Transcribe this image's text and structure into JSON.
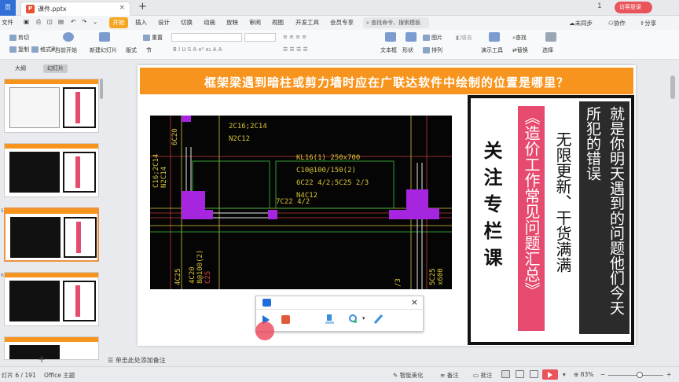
{
  "titlebar": {
    "home": "页",
    "file_name": "课件.pptx",
    "badge": "1",
    "login": "访客登录"
  },
  "menu": {
    "file": "文件",
    "start": "开始",
    "items": [
      "插入",
      "设计",
      "切换",
      "动画",
      "放映",
      "审阅",
      "视图",
      "开发工具",
      "会员专享"
    ],
    "search": "查找命令、搜索模板",
    "unsynced": "未同步",
    "collab": "协作",
    "share": "分享"
  },
  "toolbar": {
    "cut": "剪切",
    "copy": "复制",
    "format_painter": "格式刷",
    "current_start": "当前开始",
    "new_slide": "新建幻灯片",
    "layout": "版式",
    "section": "节",
    "reset": "重置",
    "textbox": "文本框",
    "shape": "形状",
    "arrange": "排列",
    "picture": "图片",
    "fill": "填充",
    "present_tool": "演示工具",
    "find": "查找",
    "replace": "替换",
    "select": "选择"
  },
  "panel": {
    "tab_outline": "大纲",
    "tab_slides": "幻灯片",
    "tooltip": "开始",
    "thumb_numbers": [
      "5",
      "6"
    ]
  },
  "slide": {
    "title": "框架梁遇到暗柱或剪力墙时应在广联达软件中绘制的位置是哪里？",
    "ad_red_text": "《造价工作常见问题汇总》",
    "ad_follow_text": "关注专栏课",
    "ad_update_text": "无限更新、干货满满",
    "ad_dark_text": "就是你明天遇到的问题他们今天所犯的错误"
  },
  "cad": {
    "labels": [
      "6C20",
      "2C16;2C14",
      "N2C12",
      "C16;2C14",
      "N2C14",
      "KL16(1) 250x700",
      "C10@100/150(2)",
      "6C22 4/2;5C25 2/3",
      "N4C12",
      "7C22 4/2",
      "4C20",
      "8@100(2)",
      "C25",
      "4C25",
      "5C25",
      "x600",
      "/3"
    ]
  },
  "notes": {
    "placeholder": "单击此处添加备注"
  },
  "status": {
    "slide_info": "灯片 6 / 191",
    "theme": "Office 主题",
    "smart": "智能美化",
    "notes_btn": "备注",
    "comments": "批注",
    "zoom": "83%"
  },
  "colors": {
    "banner": "#f7941d",
    "ad_red": "#e64a6e",
    "ad_dark": "#2b2b2b",
    "start_tab": "#f5a623",
    "cad_magenta": "#a626e0"
  }
}
